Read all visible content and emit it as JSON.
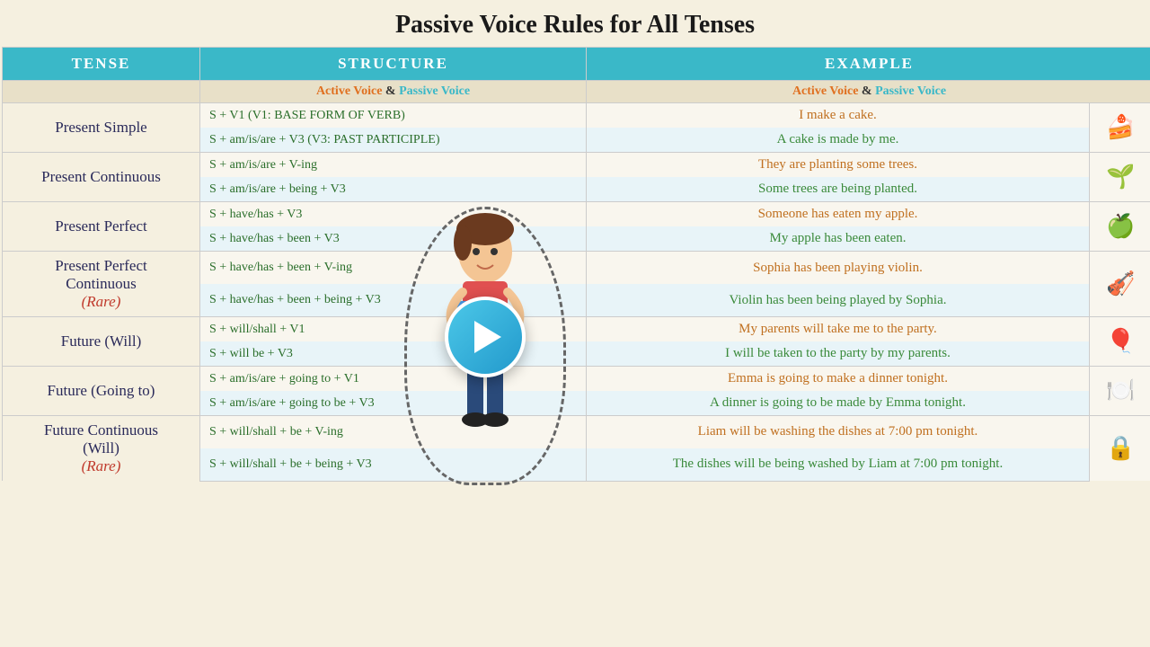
{
  "page": {
    "title": "Passive Voice Rules for All Tenses"
  },
  "header": {
    "tense_label": "TENSE",
    "structure_label": "STRUCTURE",
    "example_label": "EXAMPLE",
    "sub_active": "Active Voice",
    "sub_ampersand": "&",
    "sub_passive": "Passive Voice"
  },
  "rows": [
    {
      "tense": "Present Simple",
      "active_structure": "S + V1   (V1: BASE FORM OF VERB)",
      "passive_structure": "S + am/is/are + V3        (V3: PAST PARTICIPLE)",
      "active_example": "I make a cake.",
      "passive_example": "A cake is made by me.",
      "icon": "🍰"
    },
    {
      "tense": "Present Continuous",
      "active_structure": "S + am/is/are + V-ing",
      "passive_structure": "S + am/is/are + being + V3",
      "active_example": "They are planting some trees.",
      "passive_example": "Some trees are being planted.",
      "icon": "🌱"
    },
    {
      "tense": "Present Perfect",
      "active_structure": "S + have/has + V3",
      "passive_structure": "S + have/has + been + V3",
      "active_example": "Someone has eaten my apple.",
      "passive_example": "My apple has been eaten.",
      "icon": "🍏"
    },
    {
      "tense": "Present Perfect\nContinuous\n(Rare)",
      "rare": true,
      "active_structure": "S + have/has + been + V-ing",
      "passive_structure": "S + have/has + been + being + V3",
      "active_example": "Sophia has been playing violin.",
      "passive_example": "Violin has been being played by Sophia.",
      "icon": "🎻"
    },
    {
      "tense": "Future (Will)",
      "active_structure": "S + will/shall + V1",
      "passive_structure": "S + will be + V3",
      "active_example": "My parents will take me to the party.",
      "passive_example": "I will be taken to the party by my parents.",
      "icon": "🎈"
    },
    {
      "tense": "Future (Going to)",
      "active_structure": "S + am/is/are + going to + V1",
      "passive_structure": "S + am/is/are + going to be + V3",
      "active_example": "Emma is going to make a dinner tonight.",
      "passive_example": "A dinner is going to be made by Emma tonight.",
      "icon": "🍽️"
    },
    {
      "tense": "Future Continuous\n(Will)\n(Rare)",
      "rare": true,
      "active_structure": "S + will/shall + be + V-ing",
      "passive_structure": "S + will/shall + be + being + V3",
      "active_example": "Liam will be washing the dishes at 7:00 pm tonight.",
      "passive_example": "The dishes will be being washed by Liam at 7:00 pm tonight.",
      "icon": "🔒"
    }
  ],
  "overlay": {
    "play_label": "▶"
  }
}
